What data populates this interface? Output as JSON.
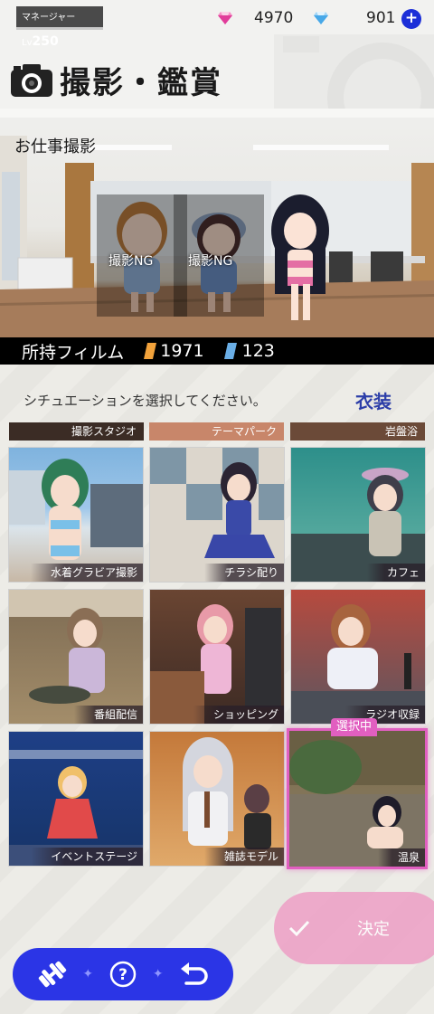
{
  "header": {
    "manager_prefix": "マネージャーLv",
    "manager_level": "250",
    "currencies": [
      {
        "icon": "gem-pink-icon",
        "amount": "4970",
        "color": "#e13c9a"
      },
      {
        "icon": "gem-blue-icon",
        "amount": "901",
        "color": "#47a8e8"
      }
    ],
    "add_icon": "plus-icon",
    "title": "撮影・鑑賞"
  },
  "scene": {
    "label": "お仕事撮影",
    "characters": [
      {
        "name": "character-1",
        "status": "撮影NG"
      },
      {
        "name": "character-2",
        "status": "撮影NG"
      },
      {
        "name": "character-3",
        "status": ""
      }
    ]
  },
  "film": {
    "label": "所持フィルム",
    "orange_count": "1971",
    "blue_count": "123",
    "orange_color": "#f2a23b",
    "blue_color": "#6aaee6"
  },
  "instruction": "シチュエーションを選択してください。",
  "costume_button": "衣装",
  "header_tabs": [
    "撮影スタジオ",
    "テーマパーク",
    "岩盤浴"
  ],
  "situations": [
    {
      "label": "水着グラビア撮影",
      "selected": false
    },
    {
      "label": "チラシ配り",
      "selected": false
    },
    {
      "label": "カフェ",
      "selected": false
    },
    {
      "label": "番組配信",
      "selected": false
    },
    {
      "label": "ショッピング",
      "selected": false
    },
    {
      "label": "ラジオ収録",
      "selected": false
    },
    {
      "label": "イベントステージ",
      "selected": false
    },
    {
      "label": "雑誌モデル",
      "selected": false
    },
    {
      "label": "温泉",
      "selected": true
    }
  ],
  "selected_badge": "選択中",
  "decide_button": "決定",
  "bottom_nav": [
    "dumbbell-icon",
    "help-icon",
    "back-icon"
  ],
  "accent_color": "#2b35e6",
  "select_color": "#e15fc0"
}
